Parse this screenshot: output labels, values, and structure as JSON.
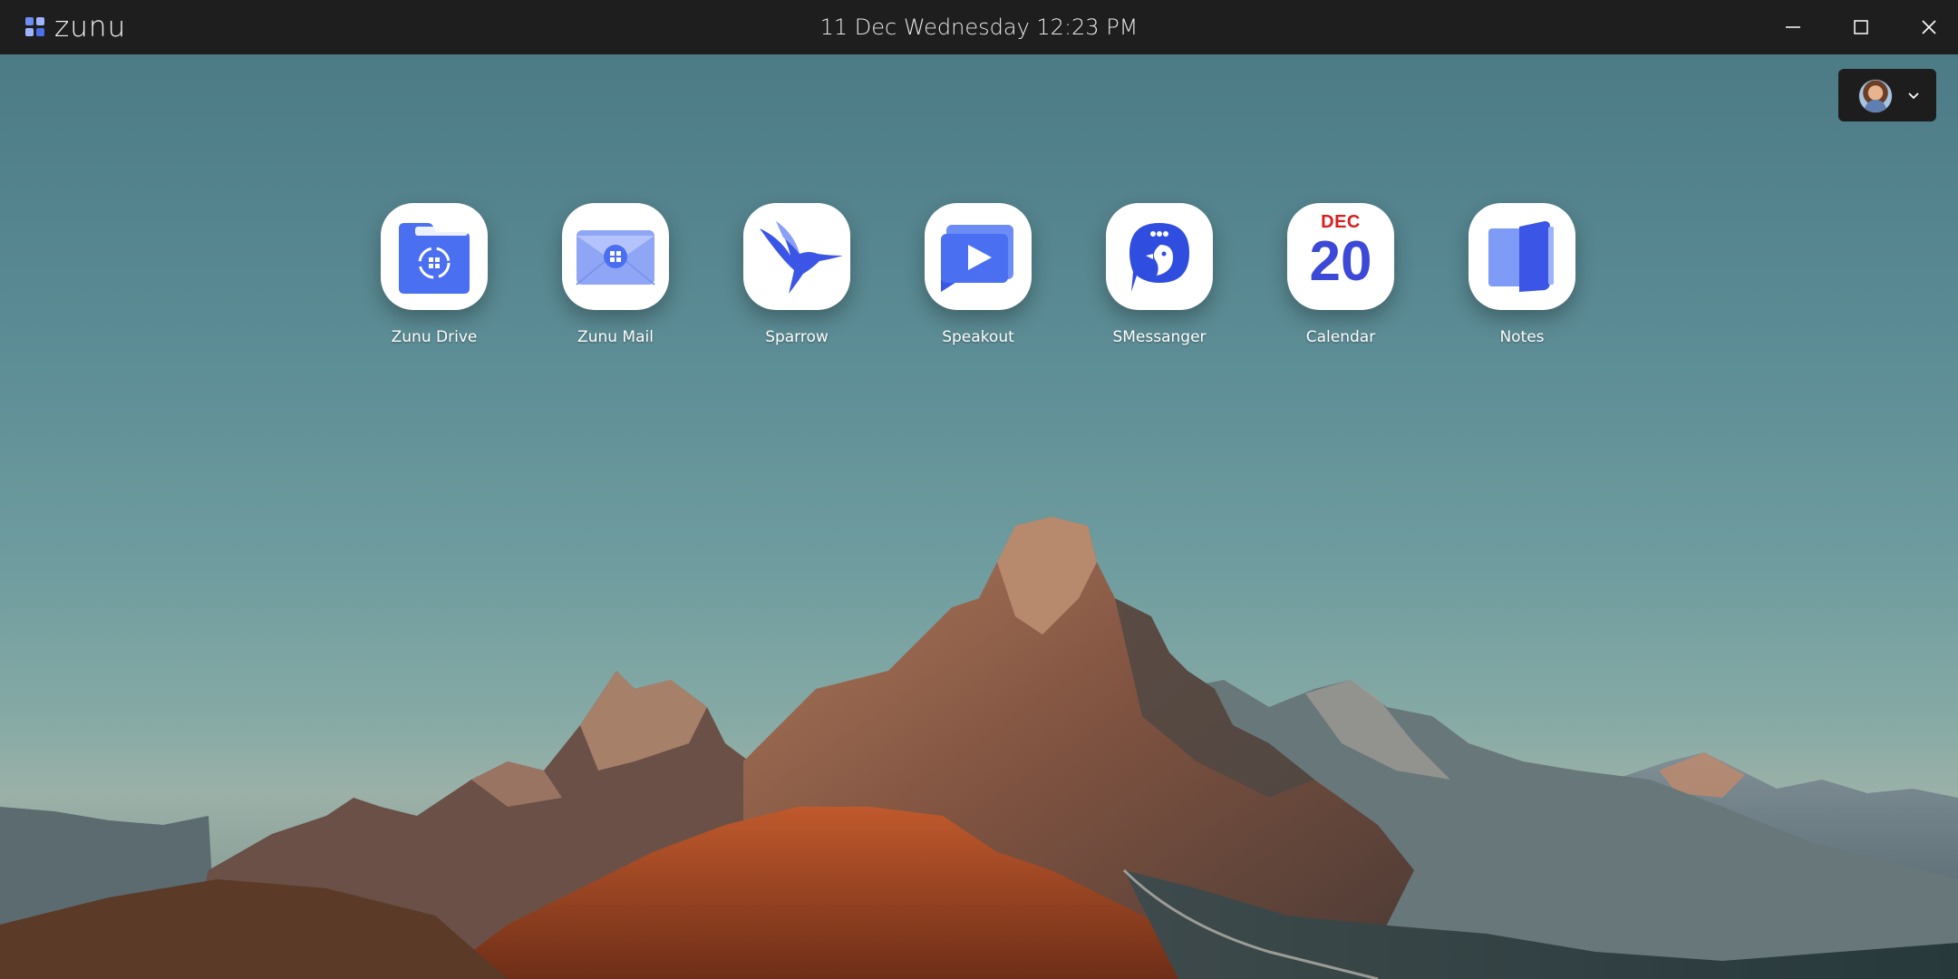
{
  "window": {
    "brand": "zunu",
    "datetime": "11 Dec Wednesday 12:23 PM",
    "controls": [
      "minimize",
      "maximize",
      "close"
    ]
  },
  "account": {
    "avatar_icon": "user-avatar-icon",
    "menu_icon": "chevron-down-icon"
  },
  "apps": [
    {
      "label": "Zunu Drive",
      "icon": "folder-sync-icon"
    },
    {
      "label": "Zunu Mail",
      "icon": "envelope-icon"
    },
    {
      "label": "Sparrow",
      "icon": "hummingbird-icon"
    },
    {
      "label": "Speakout",
      "icon": "play-presentation-icon"
    },
    {
      "label": "SMessanger",
      "icon": "chat-bird-icon"
    },
    {
      "label": "Calendar",
      "icon": "calendar-icon",
      "month": "DEC",
      "day": "20"
    },
    {
      "label": "Notes",
      "icon": "notebook-icon"
    }
  ],
  "colors": {
    "titlebar": "#1e1e1e",
    "accent_blue": "#3b55e6",
    "calendar_red": "#d81e1e",
    "sky_top": "#4c7b86",
    "rock_orange": "#b0502a"
  },
  "background": "mountain-landscape-wallpaper"
}
